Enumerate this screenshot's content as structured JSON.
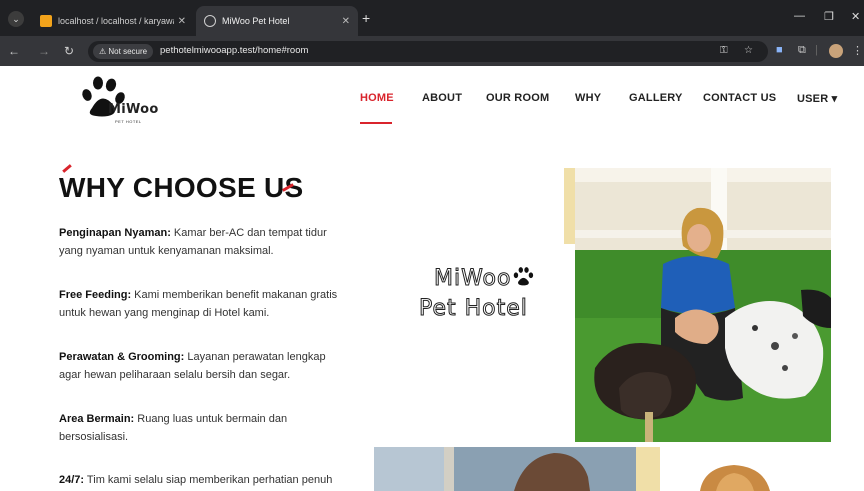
{
  "browser": {
    "tabs": [
      {
        "title": "localhost / localhost / karyawan",
        "active": false
      },
      {
        "title": "MiWoo Pet Hotel",
        "active": true
      }
    ],
    "new_tab_symbol": "+",
    "close_symbol": "✕",
    "security_label": "Not secure",
    "url": "pethotelmiwooapp.test/home#room"
  },
  "site": {
    "logo": {
      "brand": "MiWoo",
      "sub": "PET HOTEL"
    },
    "nav": [
      {
        "label": "HOME",
        "active": true
      },
      {
        "label": "ABOUT"
      },
      {
        "label": "OUR ROOM"
      },
      {
        "label": "WHY"
      },
      {
        "label": "GALLERY"
      },
      {
        "label": "CONTACT US"
      },
      {
        "label": "USER ▾"
      }
    ],
    "colors": {
      "accent": "#d9242c",
      "gold": "#f0dfa8"
    }
  },
  "why": {
    "heading": "WHY CHOOSE US",
    "features": [
      {
        "title": "Penginapan Nyaman:",
        "text": " Kamar ber-AC dan tempat tidur yang nyaman untuk kenyamanan maksimal."
      },
      {
        "title": "Free Feeding:",
        "text": " Kami memberikan benefit makanan gratis untuk hewan yang menginap di Hotel kami."
      },
      {
        "title": "Perawatan & Grooming:",
        "text": " Layanan perawatan lengkap agar hewan peliharaan selalu bersih dan segar."
      },
      {
        "title": "Area Bermain:",
        "text": " Ruang luas untuk bermain dan bersosialisasi."
      },
      {
        "title": "24/7:",
        "text": " Tim kami selalu siap memberikan perhatian penuh"
      }
    ]
  },
  "brand_card": {
    "line1": "MiWoo",
    "line2": "Pet Hotel"
  }
}
